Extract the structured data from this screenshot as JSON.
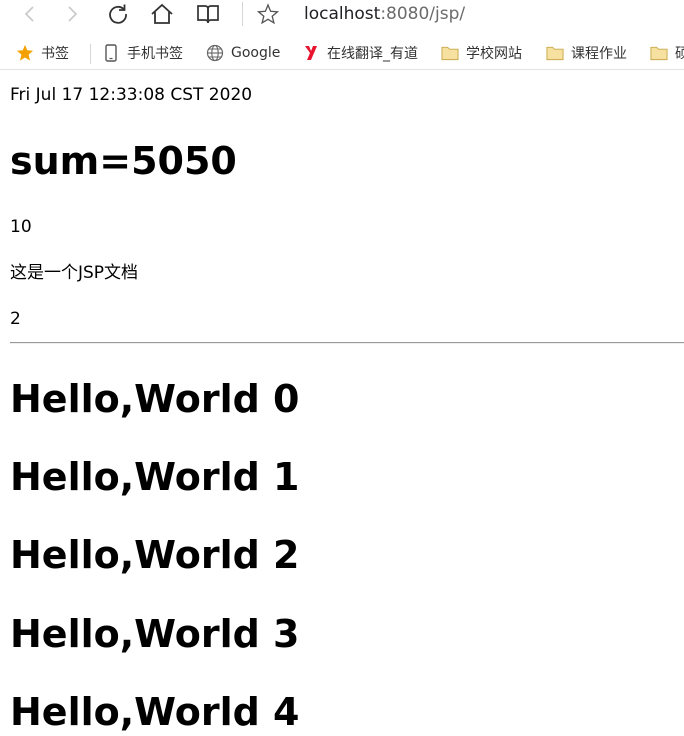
{
  "browser": {
    "url_host": "localhost",
    "url_rest": ":8080/jsp/",
    "bookmarks": [
      {
        "label": "书签",
        "icon": "star-icon"
      },
      {
        "label": "手机书签",
        "icon": "phone-icon"
      },
      {
        "label": "Google",
        "icon": "globe-icon"
      },
      {
        "label": "在线翻译_有道",
        "icon": "youdao-icon"
      },
      {
        "label": "学校网站",
        "icon": "folder-icon"
      },
      {
        "label": "课程作业",
        "icon": "folder-icon"
      },
      {
        "label": "硕",
        "icon": "folder-icon"
      }
    ],
    "colors": {
      "star": "#f4a100",
      "youdao": "#e8132f",
      "folder": "#f3d27a"
    }
  },
  "page": {
    "date": "Fri Jul 17 12:33:08 CST 2020",
    "sum_heading": "sum=5050",
    "value_10": "10",
    "jsp_text": "这是一个JSP文档",
    "value_2": "2",
    "hello_headings": [
      "Hello,World 0",
      "Hello,World 1",
      "Hello,World 2",
      "Hello,World 3",
      "Hello,World 4"
    ]
  }
}
